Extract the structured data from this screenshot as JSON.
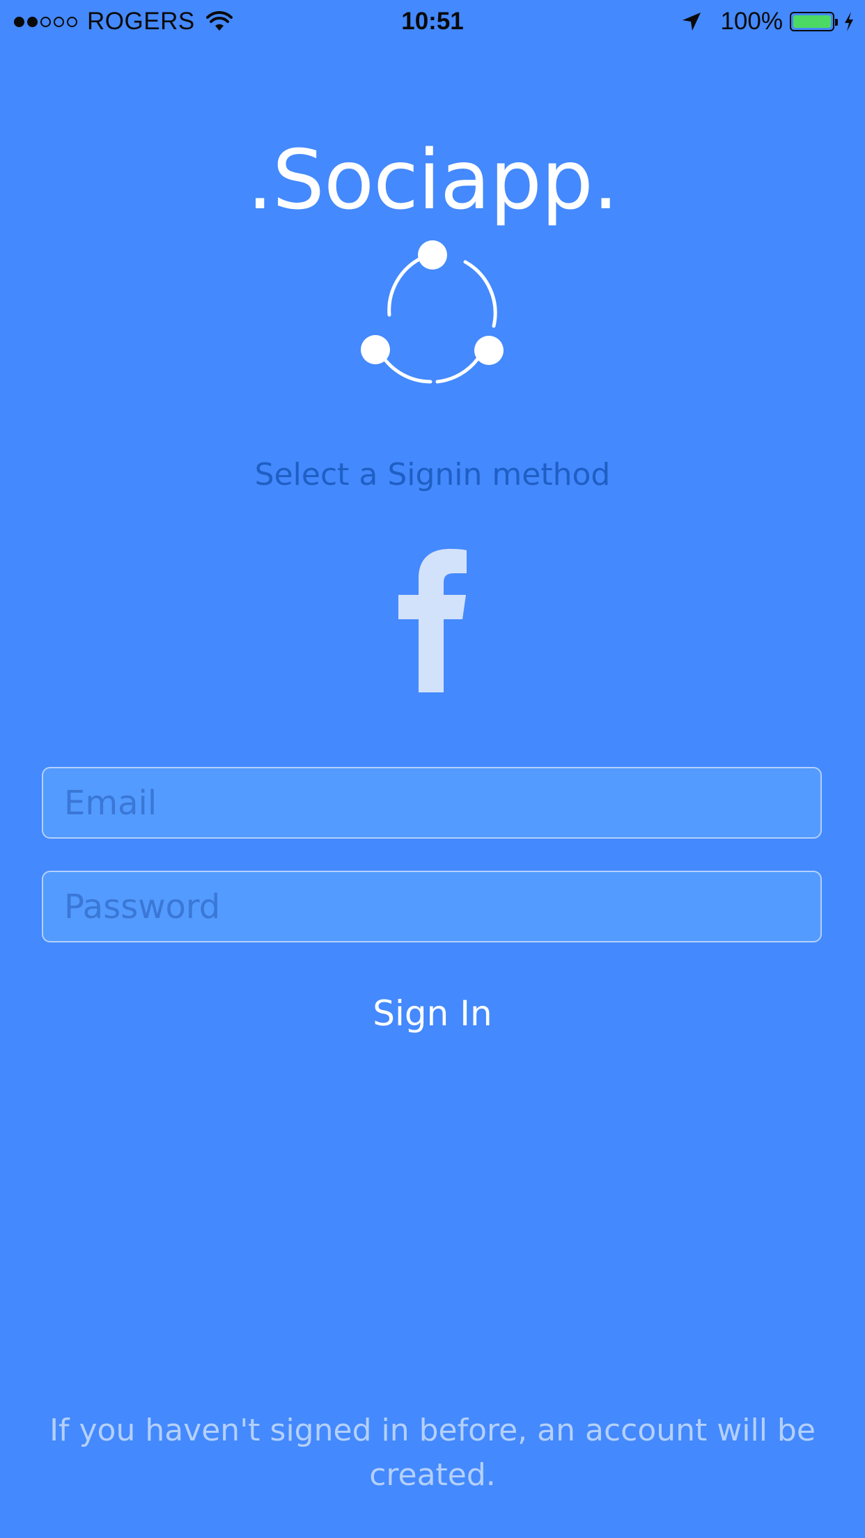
{
  "status_bar": {
    "signal_filled": 2,
    "signal_total": 5,
    "carrier": "ROGERS",
    "time": "10:51",
    "battery_percent": "100%",
    "battery_level": 1.0,
    "icons": [
      "wifi-icon",
      "location-arrow-icon",
      "battery-icon",
      "charging-bolt-icon"
    ]
  },
  "header": {
    "app_title": ".Sociapp.",
    "logo_icon": "share-circle-logo"
  },
  "signin": {
    "prompt": "Select a Signin method",
    "facebook_icon": "facebook-icon",
    "email_placeholder": "Email",
    "password_placeholder": "Password",
    "email_value": "",
    "password_value": "",
    "submit_label": "Sign In"
  },
  "footer": {
    "note": "If you haven't signed in before, an account will be created."
  },
  "colors": {
    "background": "#4489fd",
    "field_fill": "#539bfe",
    "field_border": "#b4d0fa",
    "subtitle": "#1f5fc4",
    "facebook_glyph": "#d3e2fb",
    "battery_fill": "#4cd964"
  }
}
